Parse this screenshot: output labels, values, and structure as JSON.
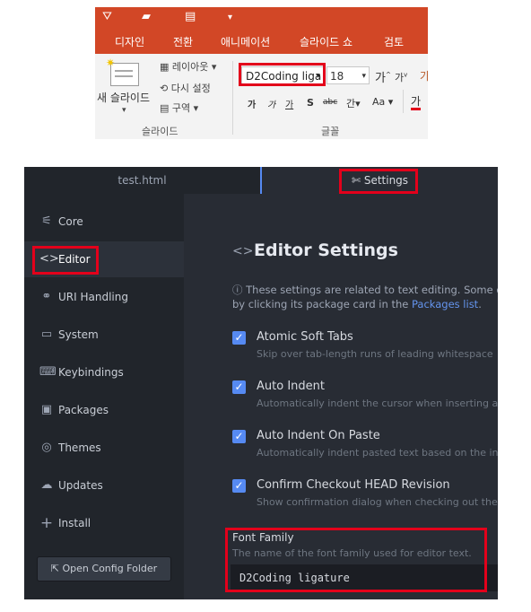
{
  "ppt": {
    "tabs": [
      "디자인",
      "전환",
      "애니메이션",
      "슬라이드 쇼",
      "검토"
    ],
    "new_slide": "새 슬라이드",
    "new_slide_arrow": "▾",
    "layout": "레이아웃",
    "reset": "다시 설정",
    "section": "구역",
    "group_slides": "슬라이드",
    "font_name": "D2Coding liga",
    "font_size": "18",
    "grow_font": "가",
    "shrink_font": "가",
    "bold": "가",
    "italic": "가",
    "underline": "가",
    "shadow": "S",
    "strike": "abc",
    "spacing": "간",
    "change_case": "Aa",
    "font_color": "가",
    "group_font": "글꼴",
    "accent_color": "#d24726"
  },
  "atom": {
    "tabs": {
      "file": "test.html",
      "settings": "Settings"
    },
    "sidebar": [
      {
        "icon": "⚟",
        "label": "Core"
      },
      {
        "icon": "<>",
        "label": "Editor"
      },
      {
        "icon": "⚭",
        "label": "URI Handling"
      },
      {
        "icon": "▭",
        "label": "System"
      },
      {
        "icon": "⌨",
        "label": "Keybindings"
      },
      {
        "icon": "▣",
        "label": "Packages"
      },
      {
        "icon": "◎",
        "label": "Themes"
      },
      {
        "icon": "☁",
        "label": "Updates"
      },
      {
        "icon": "+",
        "label": "Install"
      }
    ],
    "open_config": "Open Config Folder",
    "section_title": "Editor Settings",
    "desc_line1": "These settings are related to text editing. Some of",
    "desc_line2_pre": "by clicking its package card in the ",
    "desc_link": "Packages list",
    "desc_line2_post": ".",
    "options": [
      {
        "title": "Atomic Soft Tabs",
        "desc": "Skip over tab-length runs of leading whitespace"
      },
      {
        "title": "Auto Indent",
        "desc": "Automatically indent the cursor when inserting a"
      },
      {
        "title": "Auto Indent On Paste",
        "desc": "Automatically indent pasted text based on the in"
      },
      {
        "title": "Confirm Checkout HEAD Revision",
        "desc": "Show confirmation dialog when checking out the"
      }
    ],
    "font_family_title": "Font Family",
    "font_family_desc": "The name of the font family used for editor text.",
    "font_family_value": "D2Coding ligature",
    "highlight_color": "#e3001b",
    "accent_blue": "#568af2"
  }
}
